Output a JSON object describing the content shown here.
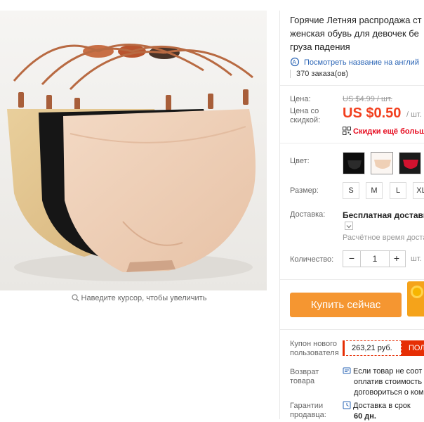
{
  "product": {
    "title_lines": [
      "Горячие Летняя распродажа ст",
      "женская обувь для девочек бе",
      "груза падения"
    ],
    "translate_link": "Посмотреть название на англий",
    "orders": "370 заказа(ов)"
  },
  "gallery": {
    "zoom_hint": "Наведите курсор, чтобы увеличить"
  },
  "pricing": {
    "price_label": "Цена:",
    "old_price": "US $4.99 / шт.",
    "discount_price_label_lines": [
      "Цена со",
      "скидкой:"
    ],
    "new_price": "US $0.50",
    "per_unit": "/ шт.",
    "app_discount": "Скидки ещё больше"
  },
  "options": {
    "color_label": "Цвет:",
    "colors": [
      "black",
      "nude",
      "red"
    ],
    "size_label": "Размер:",
    "sizes": [
      "S",
      "M",
      "L",
      "XL"
    ],
    "shipping_label": "Доставка:",
    "shipping_title": "Бесплатная доставка",
    "shipping_note": "Расчётное время доставки",
    "quantity_label": "Количество:",
    "quantity_value": "1",
    "quantity_unit": "шт."
  },
  "actions": {
    "buy_now": "Купить сейчас"
  },
  "extras": {
    "coupon_label_lines": [
      "Купон нового",
      "пользователя"
    ],
    "coupon_value": "263,21 руб.",
    "coupon_get": "ПОЛ",
    "return_label_lines": [
      "Возврат",
      "товара"
    ],
    "return_text_lines": [
      "Если товар не соот",
      "оплатив стоимость",
      "договориться о ком"
    ],
    "guarantee_label_lines": [
      "Гарантии",
      "продавца:"
    ],
    "delivery_text": "Доставка в срок",
    "delivery_days": "60 дн."
  },
  "colors": {
    "accent_red": "#f23f1e",
    "buy_orange": "#f59631",
    "link_blue": "#2a64b5"
  }
}
